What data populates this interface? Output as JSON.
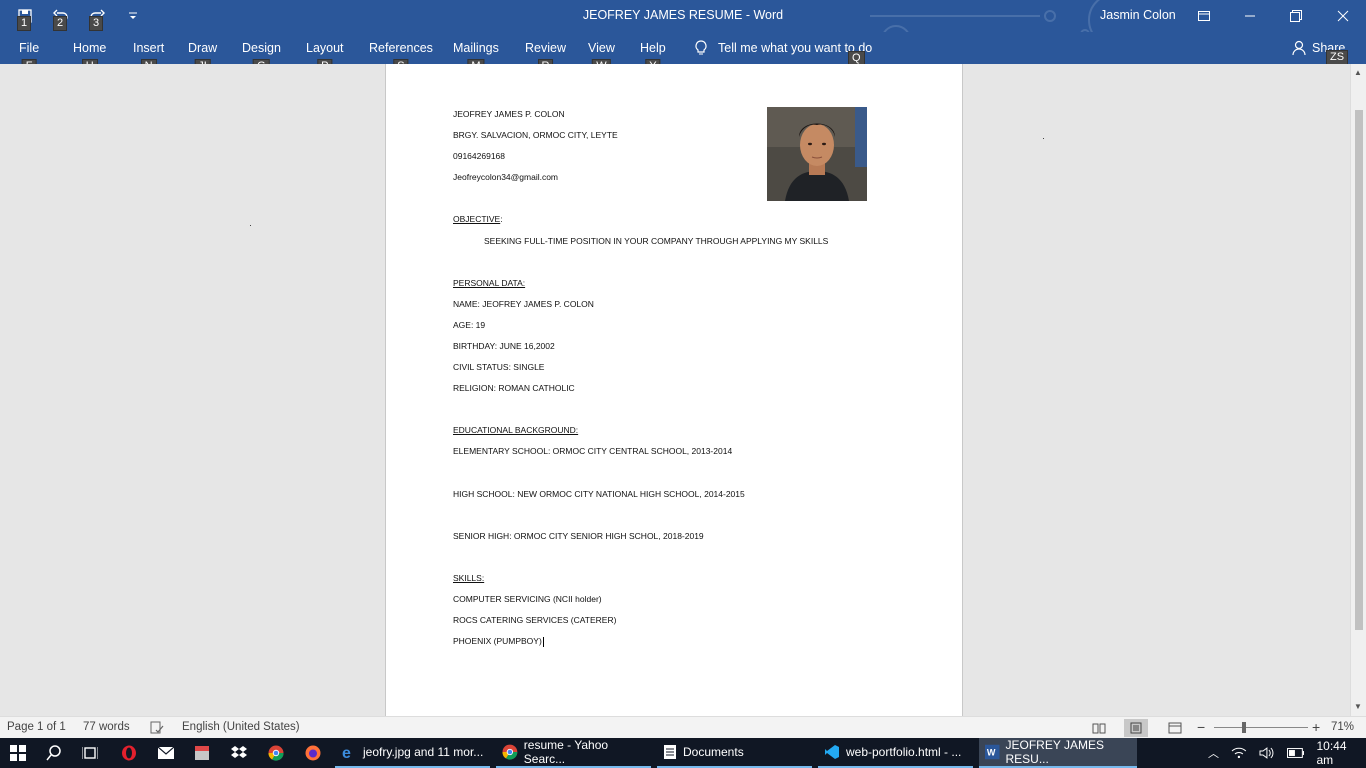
{
  "window": {
    "title": "JEOFREY JAMES RESUME  -  Word",
    "user": "Jasmin Colon"
  },
  "qat": {
    "keytips": [
      "1",
      "2",
      "3"
    ]
  },
  "ribbon": {
    "tabs": [
      {
        "label": "File",
        "keytip": "F"
      },
      {
        "label": "Home",
        "keytip": "H"
      },
      {
        "label": "Insert",
        "keytip": "N"
      },
      {
        "label": "Draw",
        "keytip": "JI"
      },
      {
        "label": "Design",
        "keytip": "G"
      },
      {
        "label": "Layout",
        "keytip": "P"
      },
      {
        "label": "References",
        "keytip": "S"
      },
      {
        "label": "Mailings",
        "keytip": "M"
      },
      {
        "label": "Review",
        "keytip": "R"
      },
      {
        "label": "View",
        "keytip": "W"
      },
      {
        "label": "Help",
        "keytip": "Y"
      }
    ],
    "tell_me": "Tell me what you want to do",
    "tell_me_keytip": "Q",
    "share": "Share",
    "share_keytip": "ZS"
  },
  "document": {
    "lines": [
      "JEOFREY JAMES P. COLON",
      "BRGY. SALVACION, ORMOC CITY, LEYTE",
      "09164269168",
      "Jeofreycolon34@gmail.com",
      "OBJECTIVE",
      ":",
      "SEEKING FULL-TIME POSITION IN YOUR COMPANY THROUGH APPLYING MY SKILLS",
      "PERSONAL DATA:",
      "NAME: JEOFREY JAMES P. COLON",
      "AGE: 19",
      "BIRTHDAY: JUNE 16,2002",
      "CIVIL STATUS: SINGLE",
      "RELIGION: ROMAN CATHOLIC",
      "EDUCATIONAL BACKGROUND:",
      "ELEMENTARY SCHOOL: ORMOC CITY CENTRAL SCHOOL, 2013-2014",
      "HIGH SCHOOL: NEW ORMOC CITY NATIONAL HIGH SCHOOL, 2014-2015",
      "SENIOR HIGH: ORMOC CITY SENIOR HIGH SCHOL, 2018-2019",
      "SKILLS:",
      "COMPUTER SERVICING (NCII holder)",
      "ROCS CATERING SERVICES (CATERER)",
      "PHOENIX (PUMPBOY)"
    ]
  },
  "status": {
    "page": "Page 1 of 1",
    "words": "77 words",
    "language": "English (United States)",
    "zoom": "71%"
  },
  "taskbar": {
    "apps": [
      "jeofry.jpg and 11 mor...",
      "resume - Yahoo Searc...",
      "Documents",
      "web-portfolio.html - ...",
      "JEOFREY JAMES RESU..."
    ],
    "time": "10:44 am"
  },
  "colors": {
    "ribbon": "#2b579a",
    "taskbar": "#101724",
    "page": "#ffffff"
  }
}
